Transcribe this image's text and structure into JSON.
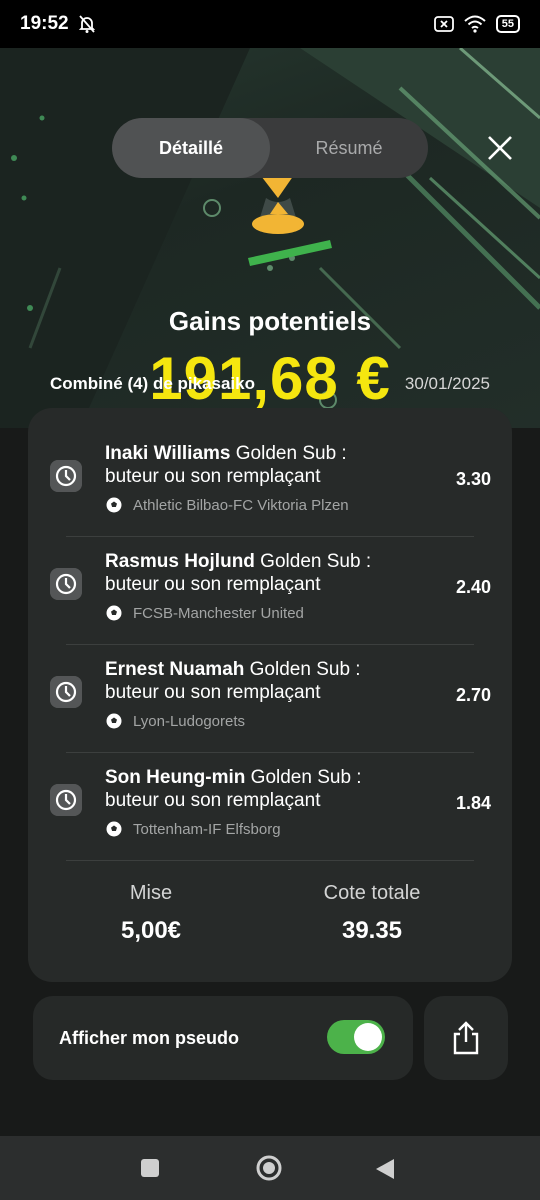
{
  "status_bar": {
    "time": "19:52",
    "battery": "55",
    "icons": [
      "bell-off-icon",
      "sim-off-icon",
      "wifi-icon",
      "battery-icon"
    ]
  },
  "view_toggle": {
    "active": "Détaillé",
    "inactive": "Résumé"
  },
  "hero": {
    "gains_label": "Gains potentiels",
    "gains_value": "191,68 €",
    "combo_label": "Combiné (4) de pikasaiko",
    "date": "30/01/2025"
  },
  "bets": [
    {
      "player": "Inaki Williams",
      "market": " Golden Sub : buteur ou son remplaçant",
      "match": "Athletic Bilbao-FC Viktoria Plzen",
      "odds": "3.30"
    },
    {
      "player": "Rasmus Hojlund",
      "market": " Golden Sub : buteur ou son remplaçant",
      "match": "FCSB-Manchester United",
      "odds": "2.40"
    },
    {
      "player": "Ernest Nuamah",
      "market": " Golden Sub : buteur ou son remplaçant",
      "match": "Lyon-Ludogorets",
      "odds": "2.70"
    },
    {
      "player": "Son Heung-min",
      "market": " Golden Sub : buteur ou son remplaçant",
      "match": "Tottenham-IF Elfsborg",
      "odds": "1.84"
    }
  ],
  "summary": {
    "stake_label": "Mise",
    "stake_value": "5,00€",
    "total_odds_label": "Cote totale",
    "total_odds_value": "39.35"
  },
  "pseudo": {
    "label": "Afficher mon pseudo",
    "enabled": true
  },
  "colors": {
    "accent_yellow": "#f5e60f",
    "toggle_green": "#4cb24a",
    "card_bg": "#272a29"
  }
}
